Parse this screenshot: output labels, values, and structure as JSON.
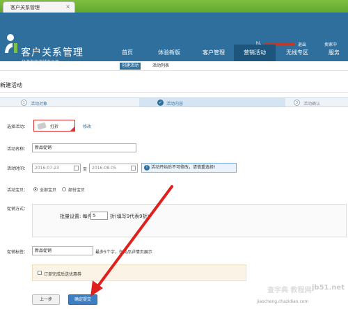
{
  "browser": {
    "tab_title": "客户关系管理",
    "tab_close": "×"
  },
  "header": {
    "app_name": "客户关系管理",
    "app_subtitle": "打造淘宝店铺会员库",
    "user_hi": "hi,",
    "logout": "退出",
    "user_center": "卖家中",
    "nav": [
      "首页",
      "体验新版",
      "客户管理",
      "营销活动",
      "无线专区",
      "服务"
    ],
    "active_nav": "营销活动",
    "accent": "#2e6f9e"
  },
  "subtabs": [
    "创建活动",
    "活动列表"
  ],
  "page_title": "新建活动",
  "steps": [
    {
      "num": "1",
      "label": "活动对象"
    },
    {
      "label": "活动内容"
    },
    {
      "num": "3",
      "label": "活动确认"
    }
  ],
  "form": {
    "activity_label": "选择活动：",
    "activity_value": "打折",
    "modify": "修改",
    "name_label": "活动名称：",
    "name_value": "新品促销",
    "time_label": "活动时间：",
    "start_date": "2016-07-23",
    "to": "至",
    "end_date": "2016-08-05",
    "time_tip_icon": "i",
    "time_tip": "活动开始后不可修改，请慎重选择!",
    "items_label": "活动宝贝：",
    "items_all": "全部宝贝",
    "items_some": "部份宝贝",
    "promo_label": "促销方式：",
    "promo_prefix": "批量设置: 每件商品",
    "promo_value": "5",
    "promo_suffix": "折(填写9代表9折)",
    "tag_label": "促销标签：",
    "tag_value": "新品促销",
    "tag_hint": "最多5个字，在商品详情页展示",
    "coupon_note": "订单完成后送优惠券"
  },
  "buttons": {
    "prev": "上一步",
    "submit": "确定提交"
  },
  "watermark": {
    "top": "查字典 教程网",
    "right": "jb51.net",
    "bottom": "jiaocheng.chazidian.com"
  }
}
